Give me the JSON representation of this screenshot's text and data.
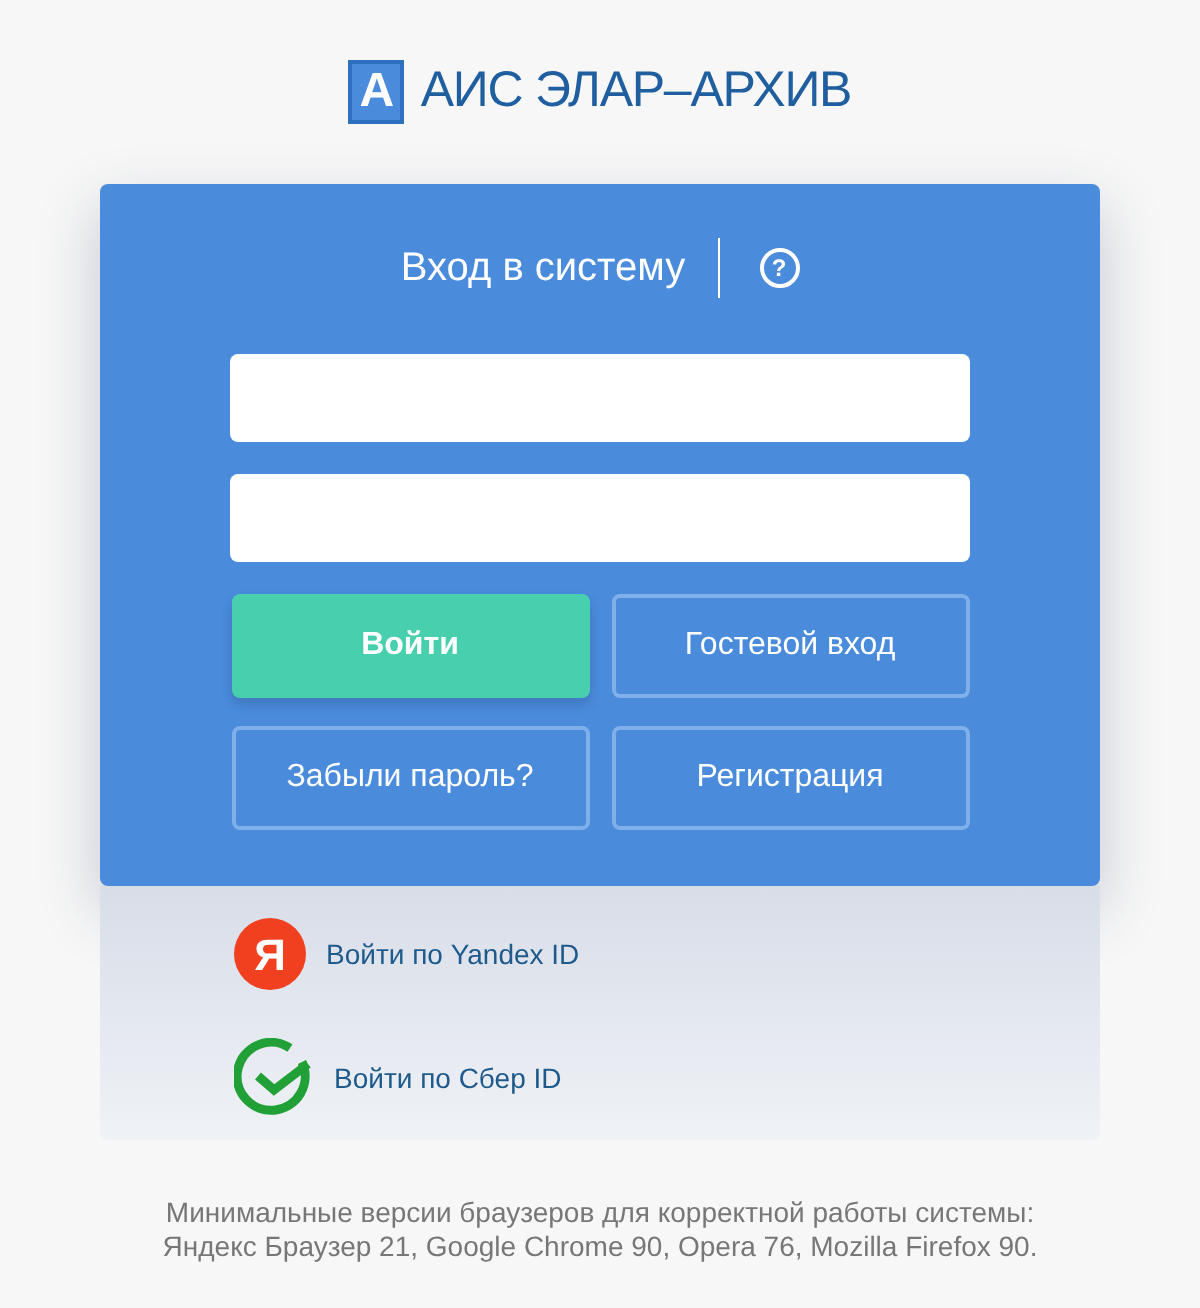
{
  "logo": {
    "letter": "А",
    "title": "АИС ЭЛАР–АРХИВ"
  },
  "login": {
    "title": "Вход в систему",
    "help": "?",
    "fields": [
      {
        "kind": "input"
      },
      {
        "kind": "input"
      }
    ],
    "buttons": [
      {
        "label": "Войти",
        "kind": "primary"
      },
      {
        "label": "Гостевой вход",
        "kind": "outline"
      },
      {
        "label": "Забыли пароль?",
        "kind": "outline"
      },
      {
        "label": "Регистрация",
        "kind": "outline"
      }
    ]
  },
  "social": [
    {
      "kind": "yandex",
      "icon_letter": "Я",
      "label": "Войти по Yandex ID"
    },
    {
      "kind": "sber",
      "label": "Войти по Сбер ID"
    }
  ],
  "footer": [
    "Минимальные версии браузеров для корректной работы системы:",
    "Яндекс Браузер 21, Google Chrome 90, Opera 76, Mozilla Firefox 90."
  ]
}
